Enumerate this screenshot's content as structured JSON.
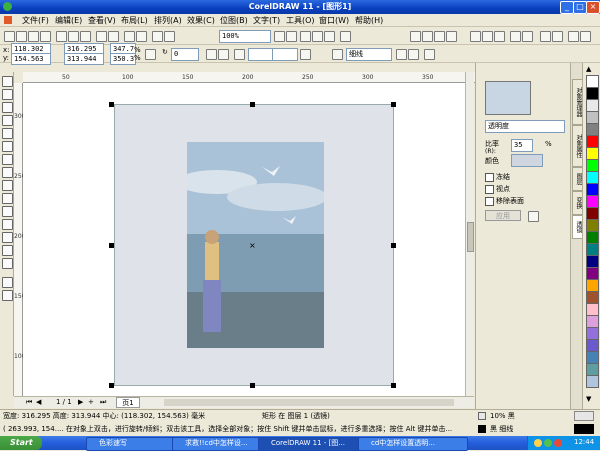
{
  "window": {
    "title": "CorelDRAW 11 - [图形1]"
  },
  "menu": [
    "文件(F)",
    "编辑(E)",
    "查看(V)",
    "布局(L)",
    "排列(A)",
    "效果(C)",
    "位图(B)",
    "文字(T)",
    "工具(O)",
    "窗口(W)",
    "帮助(H)"
  ],
  "toolbar": {
    "zoom": "100%"
  },
  "propbar": {
    "x": "118.302",
    "y": "154.563",
    "w": "316.295",
    "h": "313.944",
    "scale_w": "347.7",
    "scale_h": "350.3",
    "pct": "%",
    "rotation": "0",
    "outline": "细线"
  },
  "ruler": {
    "top": [
      "50",
      "100",
      "150",
      "200",
      "250",
      "300",
      "350"
    ],
    "left": [
      "300",
      "250",
      "200",
      "150",
      "100"
    ]
  },
  "pagenav": {
    "text": "1 / 1",
    "tab": "页1"
  },
  "docker": {
    "mode": "透明度",
    "ratio_label": "比率",
    "ratio_sub": "(R):",
    "ratio_value": "35",
    "ratio_unit": "%",
    "color_label": "颜色",
    "freeze": "冻结",
    "viewpoint": "视点",
    "remove_surface": "移除表面",
    "apply": "应用",
    "tabs": [
      "对象管理器",
      "对象属性",
      "图层",
      "变换",
      "透镜"
    ]
  },
  "palette": [
    "#ffffff",
    "#000000",
    "#e8e8e8",
    "#c0c0c0",
    "#808080",
    "#ff0000",
    "#ffff00",
    "#00ff00",
    "#00ffff",
    "#0000ff",
    "#ff00ff",
    "#800000",
    "#808000",
    "#008000",
    "#008080",
    "#000080",
    "#800080",
    "#ffa500",
    "#a0522d",
    "#ffc0cb",
    "#dda0dd",
    "#9370db",
    "#6a5acd",
    "#4682b4",
    "#5f9ea0",
    "#b0c4de"
  ],
  "status": {
    "line1": "宽度: 316.295  高度: 313.944  中心: (118.302, 154.563)  毫米",
    "line1b": "矩形 在 图层 1  (透镜)",
    "line2": "( 263.993, 154....    在对象上双击，进行旋转/倾斜；双击该工具，选择全部对象；按住 Shift 键并单击鼠标，进行多重选择；按住 Alt 键并单击...",
    "fill": "10% 黑",
    "outline": "黑  细线"
  },
  "taskbar": {
    "start": "Start",
    "tasks": [
      "色彩速写",
      "求救!!cd中怎样设...",
      "CorelDRAW 11 - [图...",
      "cd中怎样设置透明..."
    ],
    "time": "12:44"
  }
}
